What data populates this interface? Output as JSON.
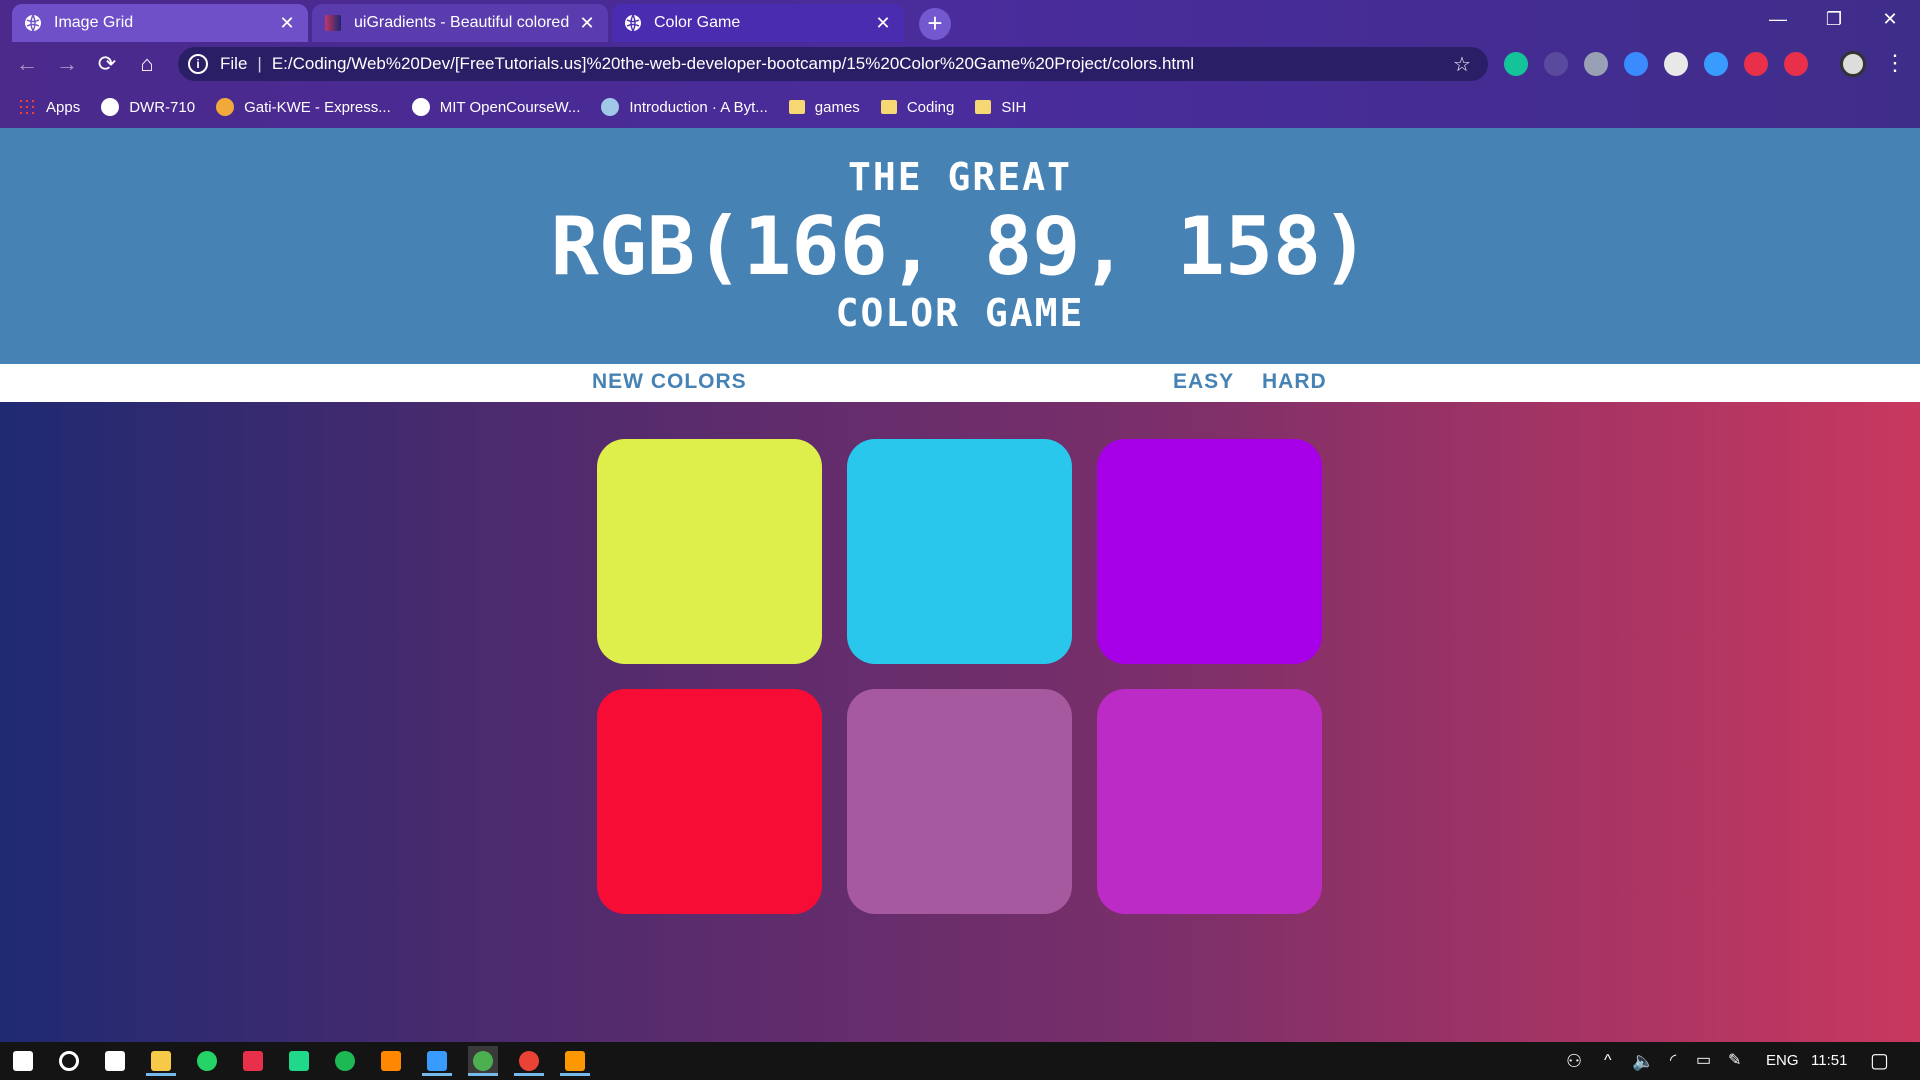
{
  "tabs": [
    {
      "title": "Image Grid",
      "icon": "globe-icon"
    },
    {
      "title": "uiGradients - Beautiful colored gradients",
      "icon": "uigradients-icon"
    },
    {
      "title": "Color Game",
      "icon": "globe-icon"
    }
  ],
  "window_controls": {
    "minimize": "—",
    "restore": "❐",
    "close": "✕"
  },
  "toolbar": {
    "back": "←",
    "forward": "→",
    "reload": "⟳",
    "home": "⌂",
    "info": "i",
    "scheme": "File",
    "separator": "|",
    "url": "E:/Coding/Web%20Dev/[FreeTutorials.us]%20the-web-developer-bootcamp/15%20Color%20Game%20Project/colors.html",
    "star": "☆",
    "menu": "⋮"
  },
  "extensions": [
    {
      "name": "grammarly-icon",
      "color": "#15c39a"
    },
    {
      "name": "devtools-icon",
      "color": "#5a4a9e"
    },
    {
      "name": "camera-icon",
      "color": "#9aa0b4"
    },
    {
      "name": "wave-icon",
      "color": "#3a8bff"
    },
    {
      "name": "speed-icon",
      "color": "#e8e8e8"
    },
    {
      "name": "search-ext-icon",
      "color": "#3a9bff"
    },
    {
      "name": "pinterest-ext-icon",
      "color": "#e8304a"
    },
    {
      "name": "shield-ext-icon",
      "color": "#e8304a"
    }
  ],
  "bookmarks": [
    {
      "label": "Apps",
      "icon": "apps-grid-icon",
      "color": "#ea4335"
    },
    {
      "label": "DWR-710",
      "icon": "globe-icon",
      "color": "#ffffff"
    },
    {
      "label": "Gati-KWE - Express...",
      "icon": "gati-icon",
      "color": "#f2a93b"
    },
    {
      "label": "MIT OpenCourseW...",
      "icon": "mit-ocw-icon",
      "color": "#ffffff"
    },
    {
      "label": "Introduction · A Byt...",
      "icon": "book-icon",
      "color": "#a0c8e8"
    },
    {
      "label": "games",
      "icon": "folder-icon",
      "color": "#f7d774"
    },
    {
      "label": "Coding",
      "icon": "folder-icon",
      "color": "#f7d774"
    },
    {
      "label": "SIH",
      "icon": "folder-icon",
      "color": "#f7d774"
    }
  ],
  "game": {
    "title_top": "THE GREAT",
    "rgb_display": "RGB(166, 89, 158)",
    "title_bottom": "COLOR GAME",
    "new_colors_label": "NEW COLORS",
    "easy_label": "EASY",
    "hard_label": "HARD",
    "header_color": "#4682b4",
    "squares": [
      "#deee4a",
      "#29c7ec",
      "#a700e8",
      "#f70c36",
      "#a6599e",
      "#bc2bc6"
    ]
  },
  "taskbar": {
    "apps": [
      {
        "name": "windows-start-icon",
        "color": "#ffffff"
      },
      {
        "name": "cortana-search-icon",
        "color": "#ffffff"
      },
      {
        "name": "task-view-icon",
        "color": "#ffffff"
      },
      {
        "name": "file-explorer-icon",
        "color": "#f7c948"
      },
      {
        "name": "whatsapp-icon",
        "color": "#25d366"
      },
      {
        "name": "intellij-icon",
        "color": "#e8304a"
      },
      {
        "name": "pycharm-icon",
        "color": "#21d789"
      },
      {
        "name": "spotify-icon",
        "color": "#1db954"
      },
      {
        "name": "vlc-icon",
        "color": "#ff8800"
      },
      {
        "name": "terminal-icon",
        "color": "#3a9bff"
      },
      {
        "name": "chrome-icon",
        "color": "#4caf50"
      },
      {
        "name": "chrome-alt-icon",
        "color": "#ea4335"
      },
      {
        "name": "sublime-icon",
        "color": "#ff9800"
      }
    ],
    "tray": {
      "language": "ENG",
      "time": "11:51"
    }
  }
}
